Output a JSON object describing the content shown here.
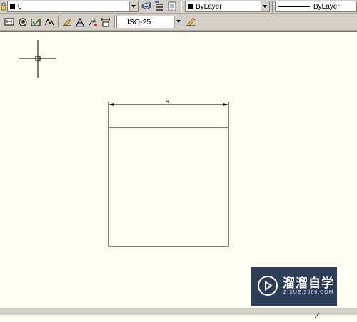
{
  "toolbar1": {
    "layer_value": "0",
    "color_value": "ByLayer",
    "linetype_value": "ByLayer"
  },
  "toolbar2": {
    "dimstyle_value": "ISO-25"
  },
  "drawing": {
    "dimension_value": "80"
  },
  "watermark": {
    "brand_cn": "溜溜自学",
    "brand_url": "ZIXUE.3066.COM"
  },
  "colors": {
    "canvas_bg": "#fefdf0",
    "toolbar_bg": "#d4d0c8",
    "logo_bg": "#1b2d4b"
  }
}
